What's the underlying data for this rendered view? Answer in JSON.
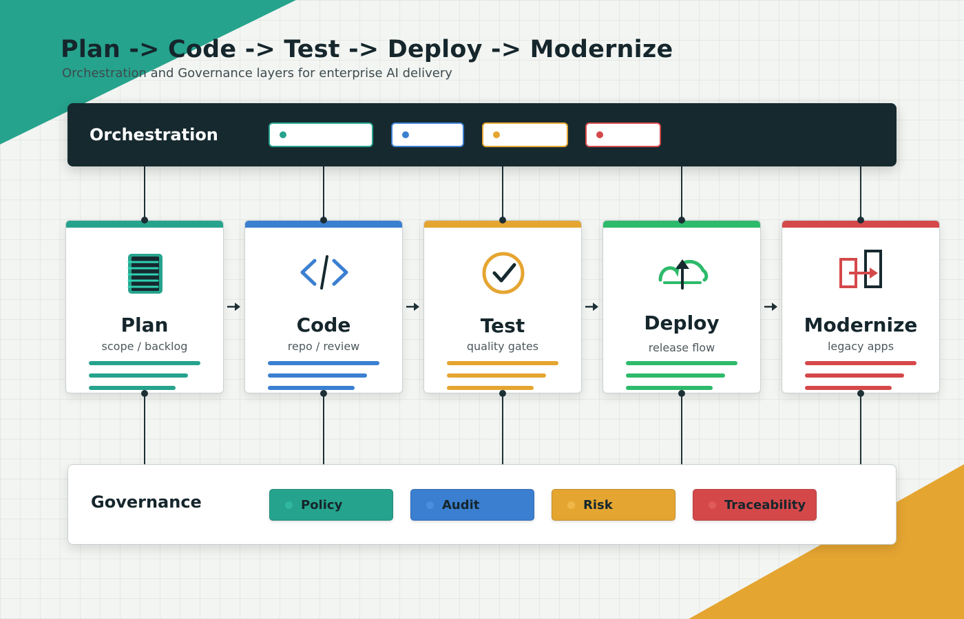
{
  "header": {
    "title": "Plan -> Code -> Test -> Deploy -> Modernize",
    "subtitle": "Orchestration and Governance layers for enterprise AI delivery"
  },
  "orchestration": {
    "title": "Orchestration",
    "chips": [
      {
        "label": "",
        "color": "#26a38d"
      },
      {
        "label": "",
        "color": "#3b7fd0"
      },
      {
        "label": "",
        "color": "#e5a531"
      },
      {
        "label": "",
        "color": "#d5484a"
      }
    ]
  },
  "stages": [
    {
      "name": "Plan",
      "subtitle": "scope / backlog",
      "color": "#26a38d",
      "icon": "document-list-icon"
    },
    {
      "name": "Code",
      "subtitle": "repo / review",
      "color": "#3b7fd0",
      "icon": "code-brackets-icon"
    },
    {
      "name": "Test",
      "subtitle": "quality gates",
      "color": "#e5a531",
      "icon": "checkmark-circle-icon"
    },
    {
      "name": "Deploy",
      "subtitle": "release flow",
      "color": "#2dba6a",
      "icon": "cloud-upload-icon"
    },
    {
      "name": "Modernize",
      "subtitle": "legacy apps",
      "color": "#d5484a",
      "icon": "migrate-arrow-icon"
    }
  ],
  "governance": {
    "title": "Governance",
    "items": [
      {
        "label": "Policy",
        "color": "#26a38d"
      },
      {
        "label": "Audit",
        "color": "#3b7fd0"
      },
      {
        "label": "Risk",
        "color": "#e5a531"
      },
      {
        "label": "Traceability",
        "color": "#d5484a"
      }
    ]
  },
  "colors": {
    "dark": "#16292f",
    "teal": "#26a38d",
    "blue": "#3b7fd0",
    "amber": "#e5a531",
    "green": "#2dba6a",
    "red": "#d5484a"
  }
}
